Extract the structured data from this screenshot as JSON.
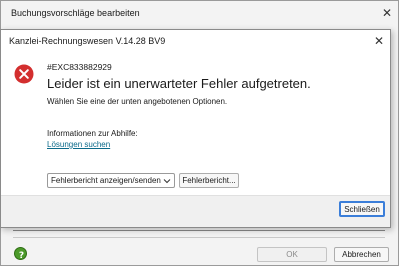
{
  "outer_window": {
    "title": "Buchungsvorschläge bearbeiten",
    "ok_label": "OK",
    "cancel_label": "Abbrechen"
  },
  "dialog": {
    "title": "Kanzlei-Rechnungswesen V.14.28 BV9",
    "error_code": "#EXC833882929",
    "heading": "Leider ist ein unerwarteter Fehler aufgetreten.",
    "subtext": "Wählen Sie eine der unten angebotenen Optionen.",
    "info_label": "Informationen zur Abhilfe:",
    "solutions_link": "Lösungen suchen",
    "select_value": "Fehlerbericht anzeigen/senden",
    "report_button_label": "Fehlerbericht...",
    "close_button_label": "Schließen"
  },
  "icons": {
    "error": "error-icon",
    "close": "close-icon",
    "help": "help-icon",
    "dropdown": "chevron-down-icon"
  },
  "colors": {
    "error_red": "#d32f2f",
    "link": "#0b6a8a",
    "focus_border": "#3b7ed9",
    "help_green": "#4c9a2a"
  }
}
